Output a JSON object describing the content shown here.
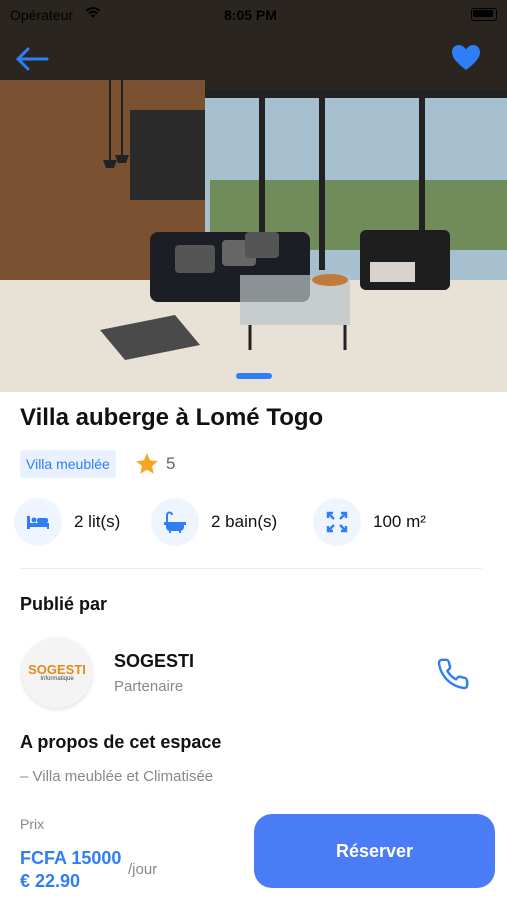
{
  "status_bar": {
    "carrier": "Opérateur",
    "time": "8:05 PM"
  },
  "listing": {
    "title": "Villa auberge à Lomé Togo",
    "type_badge": "Villa meublée",
    "rating": "5",
    "features": [
      {
        "icon": "bed-icon",
        "label": "2 lit(s)"
      },
      {
        "icon": "bathtub-icon",
        "label": "2 bain(s)"
      },
      {
        "icon": "area-expand-icon",
        "label": "100 m²"
      }
    ],
    "carousel_active_index": 0
  },
  "publisher": {
    "heading": "Publié par",
    "name": "SOGESTI",
    "role": "Partenaire",
    "logo_text": "SOGESTI",
    "logo_subtext": "Informatique"
  },
  "about": {
    "heading": "A propos de cet espace",
    "text": "– Villa meublée et Climatisée"
  },
  "pricing": {
    "label": "Prix",
    "fcfa": "FCFA 15000",
    "eur": "€ 22.90",
    "per": "/jour"
  },
  "actions": {
    "book_label": "Réserver"
  },
  "colors": {
    "accent": "#2f7ef5",
    "button": "#4a7cf5",
    "badge_bg": "#e8f1fd",
    "star": "#f5a623"
  }
}
